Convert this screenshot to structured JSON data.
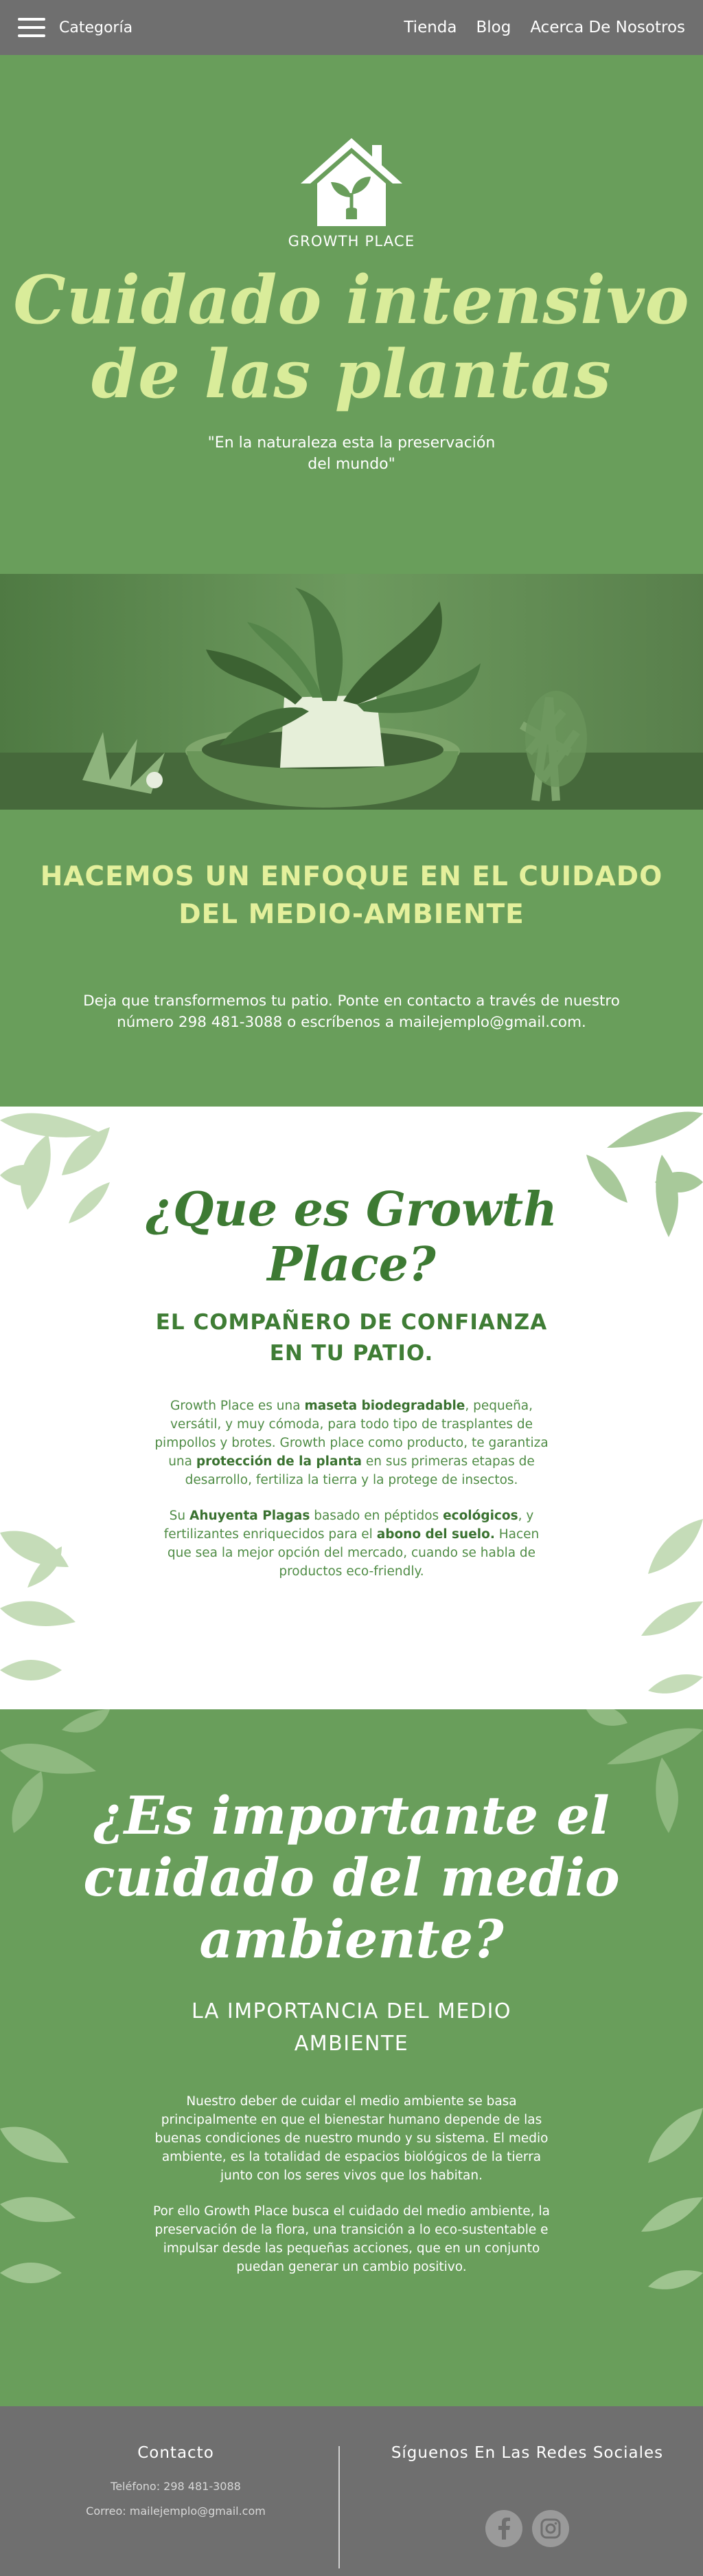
{
  "nav": {
    "menu_label": "Categoría",
    "links": [
      "Tienda",
      "Blog",
      "Acerca De Nosotros"
    ]
  },
  "hero": {
    "brand": "GROWTH PLACE",
    "title_line1": "Cuidado intensivo",
    "title_line2": "de las plantas",
    "quote_line1": "\"En la naturaleza esta la preservación",
    "quote_line2": "del mundo\""
  },
  "enfoque": {
    "title_line1": "HACEMOS UN ENFOQUE EN EL CUIDADO",
    "title_line2": "DEL MEDIO-AMBIENTE",
    "text_line1": "Deja que transformemos tu patio. Ponte en contacto a través de nuestro",
    "text_line2": "número 298 481-3088 o escríbenos a mailejemplo@gmail.com."
  },
  "quees": {
    "title_line1": "¿Que es Growth",
    "title_line2": "Place?",
    "subtitle_line1": "EL COMPAÑERO DE CONFIANZA",
    "subtitle_line2": "EN TU PATIO.",
    "p1_a": "Growth Place es una ",
    "p1_b": "maseta biodegradable",
    "p1_c": ", pequeña, versátil, y muy cómoda, para todo tipo de trasplantes de pimpollos y brotes. Growth place como producto, te garantiza una ",
    "p1_d": "protección de la planta",
    "p1_e": " en sus primeras etapas de desarrollo, fertiliza la tierra y la protege de insectos.",
    "p2_a": "Su ",
    "p2_b": "Ahuyenta Plagas",
    "p2_c": " basado en péptidos ",
    "p2_d": "ecológicos",
    "p2_e": ", y fertilizantes enriquecidos para el ",
    "p2_f": "abono del suelo.",
    "p2_g": " Hacen que sea la mejor opción del mercado, cuando se habla de productos eco-friendly."
  },
  "importante": {
    "title_line1": "¿Es importante el",
    "title_line2": "cuidado del medio",
    "title_line3": "ambiente?",
    "subtitle_line1": "LA IMPORTANCIA DEL MEDIO",
    "subtitle_line2": "AMBIENTE",
    "p1": "Nuestro deber de cuidar el medio ambiente se basa principalmente en que el bienestar humano depende de las buenas condiciones de nuestro mundo y su sistema. El medio ambiente, es la totalidad de espacios biológicos de la tierra junto con los seres vivos que los habitan.",
    "p2": "Por ello Growth Place busca el cuidado del medio ambiente, la preservación de la flora, una transición a lo eco-sustentable e impulsar desde las pequeñas acciones, que en un conjunto puedan generar un cambio positivo."
  },
  "footer": {
    "contact_title": "Contacto",
    "phone": "Teléfono: 298 481-3088",
    "email": "Correo: mailejemplo@gmail.com",
    "social_title": "Síguenos En Las Redes Sociales",
    "social_icons": [
      "facebook-icon",
      "instagram-icon"
    ]
  },
  "colors": {
    "green": "#699e5b",
    "light_green_title": "#d9ec9a",
    "gray": "#6f6f6f",
    "dark_green_text": "#3d7a33"
  }
}
